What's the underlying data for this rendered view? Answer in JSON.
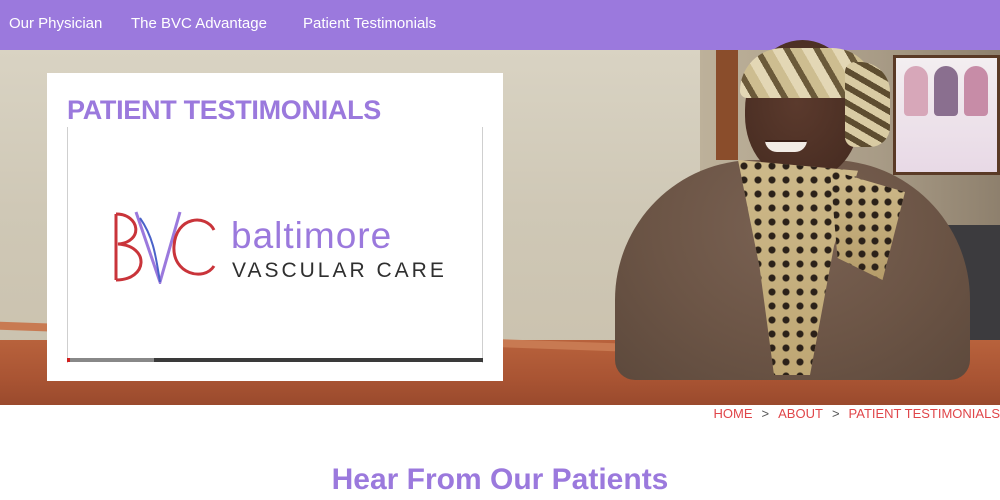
{
  "nav": {
    "items": [
      {
        "label": "Our Physician"
      },
      {
        "label": "The BVC Advantage"
      },
      {
        "label": "Patient Testimonials"
      }
    ]
  },
  "hero": {
    "card": {
      "title": "PATIENT TESTIMONIALS",
      "video": {
        "logo": {
          "monogram": "BVC",
          "wordmark": "baltimore",
          "subtitle": "VASCULAR CARE"
        },
        "progress_played_fraction": 0.005,
        "progress_buffered_fraction": 0.21
      }
    }
  },
  "breadcrumb": {
    "items": [
      "HOME",
      "ABOUT",
      "PATIENT TESTIMONIALS"
    ],
    "separator": ">"
  },
  "main": {
    "heading": "Hear From Our Patients"
  },
  "colors": {
    "brand_purple": "#9b79dd",
    "breadcrumb_red": "#e0464a",
    "logo_red": "#c9343a"
  }
}
